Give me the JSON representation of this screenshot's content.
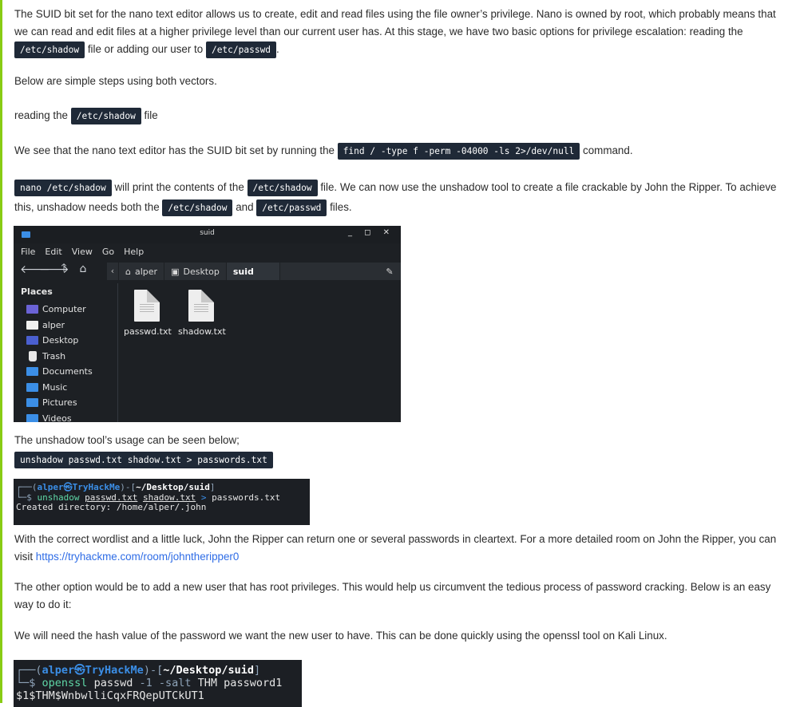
{
  "colors": {
    "accent": "#88cc14",
    "code_bg": "#1f2937",
    "link": "#2e6ce6"
  },
  "p1": {
    "t1": "The SUID bit set for the nano text editor allows us to create, edit and read files using the file owner’s privilege. Nano is owned by root, which probably means that we can read and edit files at a higher privilege level than our current user has. At this stage, we have two basic options for privilege escalation: reading the ",
    "c1": "/etc/shadow",
    "t2": " file or adding our user to ",
    "c2": "/etc/passwd",
    "t3": "."
  },
  "p2": "Below are simple steps using both vectors.",
  "p3": {
    "t1": "reading the ",
    "c1": "/etc/shadow",
    "t2": " file"
  },
  "p4": {
    "t1": "We see that the nano text editor has the SUID bit set by running the ",
    "c1": "find / -type f -perm -04000 -ls 2>/dev/null",
    "t2": " command."
  },
  "p5": {
    "c1": "nano /etc/shadow",
    "t1": " will print the contents of the ",
    "c2": "/etc/shadow",
    "t2": " file. We can now use the unshadow tool to create a file crackable by John the Ripper. To achieve this, unshadow needs both the ",
    "c3": "/etc/shadow",
    "t3": " and ",
    "c4": "/etc/passwd",
    "t4": " files."
  },
  "file_manager": {
    "title": "suid",
    "window_controls": "_ ◻ ✕",
    "menu": [
      "File",
      "Edit",
      "View",
      "Go",
      "Help"
    ],
    "path": [
      "alper",
      "Desktop",
      "suid"
    ],
    "sidebar_heading": "Places",
    "places": [
      {
        "label": "Computer",
        "icon": "computer-icon"
      },
      {
        "label": "alper",
        "icon": "home-folder-icon"
      },
      {
        "label": "Desktop",
        "icon": "desktop-icon"
      },
      {
        "label": "Trash",
        "icon": "trash-icon"
      },
      {
        "label": "Documents",
        "icon": "documents-folder-icon"
      },
      {
        "label": "Music",
        "icon": "music-folder-icon"
      },
      {
        "label": "Pictures",
        "icon": "pictures-folder-icon"
      },
      {
        "label": "Videos",
        "icon": "videos-folder-icon"
      }
    ],
    "files": [
      "passwd.txt",
      "shadow.txt"
    ]
  },
  "p6": "The unshadow tool’s usage can be seen below;",
  "code_unshadow": "unshadow passwd.txt shadow.txt > passwords.txt",
  "term1": {
    "open": "┌──(",
    "user": "alper",
    "at": "㉿",
    "host": "TryHackMe",
    "mid": ")-[",
    "cwd": "~/Desktop/suid",
    "close": "]",
    "prompt": "└─$ ",
    "cmd": "unshadow",
    "arg1": "passwd.txt",
    "arg2": "shadow.txt",
    "redir": ">",
    "arg3": "passwords.txt",
    "output": "Created directory: /home/alper/.john"
  },
  "p7": {
    "t1": "With the correct wordlist and a little luck, John the Ripper can return one or several passwords in cleartext. For a more detailed room on John the Ripper, you can visit ",
    "link": "https://tryhackme.com/room/johntheripper0"
  },
  "p8": "The other option would be to add a new user that has root privileges. This would help us circumvent the tedious process of password cracking. Below is an easy way to do it:",
  "p9": "We will need the hash value of the password we want the new user to have. This can be done quickly using the openssl tool on Kali Linux.",
  "term2": {
    "open": "┌──(",
    "user": "alper",
    "at": "㉿",
    "host": "TryHackMe",
    "mid": ")-[",
    "cwd": "~/Desktop/suid",
    "close": "]",
    "prompt": "└─$ ",
    "cmd": "openssl",
    "arg1": "passwd",
    "flag1": "-1",
    "flag2": "-salt",
    "arg2": "THM password1",
    "output": "$1$THM$WnbwlliCqxFRQepUTCkUT1"
  }
}
